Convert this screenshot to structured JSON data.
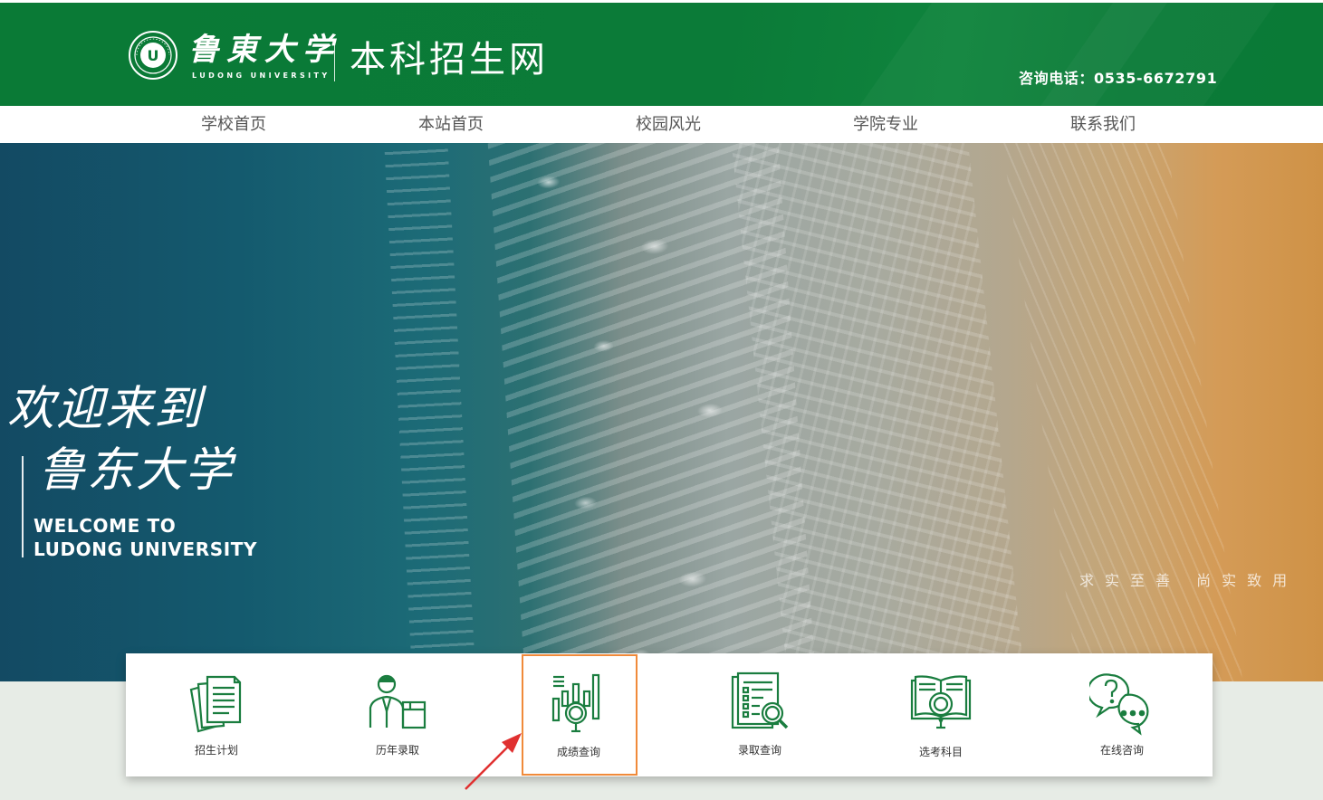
{
  "header": {
    "logo_cn": "鲁東大学",
    "logo_en": "LUDONG UNIVERSITY",
    "site_title": "本科招生网",
    "phone": "咨询电话：0535-6672791"
  },
  "nav": {
    "items": [
      {
        "label": "学校首页"
      },
      {
        "label": "本站首页"
      },
      {
        "label": "校园风光"
      },
      {
        "label": "学院专业"
      },
      {
        "label": "联系我们"
      }
    ]
  },
  "banner": {
    "cn_line1": "欢迎来到",
    "cn_line2": "鲁东大学",
    "en_line1": "WELCOME TO",
    "en_line2": "LUDONG UNIVERSITY",
    "motto": "求实至善 尚实致用"
  },
  "quick_links": {
    "items": [
      {
        "label": "招生计划",
        "icon": "documents-icon"
      },
      {
        "label": "历年录取",
        "icon": "person-box-icon"
      },
      {
        "label": "成绩查询",
        "icon": "chart-magnifier-icon",
        "highlighted": true
      },
      {
        "label": "录取查询",
        "icon": "list-magnifier-icon"
      },
      {
        "label": "选考科目",
        "icon": "book-magnifier-icon"
      },
      {
        "label": "在线咨询",
        "icon": "chat-question-icon"
      }
    ]
  },
  "colors": {
    "brand_green": "#0b7b38",
    "icon_green": "#1a7d3f",
    "highlight_orange": "#f08a3a",
    "arrow_red": "#e03030"
  }
}
